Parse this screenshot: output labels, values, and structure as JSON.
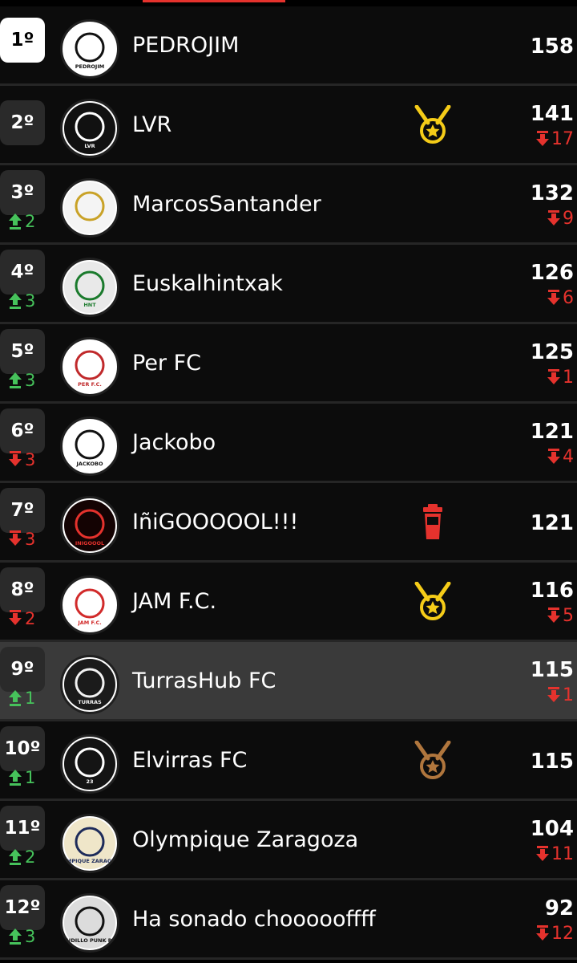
{
  "standings": [
    {
      "rank": "1º",
      "name": "PEDROJIM",
      "points": "158",
      "avatar_text": "PEDROJIM",
      "avatar_bg": "#ffffff",
      "avatar_fg": "#111111"
    },
    {
      "rank": "2º",
      "name": "LVR",
      "points": "141",
      "delta": "17",
      "delta_dir": "down",
      "badge": "medal-gold-icon",
      "avatar_text": "LVR",
      "avatar_bg": "#111111",
      "avatar_fg": "#ffffff"
    },
    {
      "rank": "3º",
      "name": "MarcosSantander",
      "points": "132",
      "delta": "9",
      "delta_dir": "down",
      "rank_change": "2",
      "rank_change_dir": "up",
      "avatar_text": "",
      "avatar_bg": "#f4f4f4",
      "avatar_fg": "#c9a227"
    },
    {
      "rank": "4º",
      "name": "Euskalhintxak",
      "points": "126",
      "delta": "6",
      "delta_dir": "down",
      "rank_change": "3",
      "rank_change_dir": "up",
      "avatar_text": "HNT",
      "avatar_bg": "#e9e9e9",
      "avatar_fg": "#1a7a2c"
    },
    {
      "rank": "5º",
      "name": "Per FC",
      "points": "125",
      "delta": "1",
      "delta_dir": "down",
      "rank_change": "3",
      "rank_change_dir": "up",
      "avatar_text": "PER F.C.",
      "avatar_bg": "#ffffff",
      "avatar_fg": "#c0292b"
    },
    {
      "rank": "6º",
      "name": "Jackobo",
      "points": "121",
      "delta": "4",
      "delta_dir": "down",
      "rank_change": "3",
      "rank_change_dir": "down",
      "avatar_text": "JACKOBO",
      "avatar_bg": "#ffffff",
      "avatar_fg": "#111111"
    },
    {
      "rank": "7º",
      "name": "IñiGOOOOOL!!!",
      "points": "121",
      "rank_change": "3",
      "rank_change_dir": "down",
      "badge": "trash-icon",
      "avatar_text": "INIGOOOL",
      "avatar_bg": "#140303",
      "avatar_fg": "#e5322d"
    },
    {
      "rank": "8º",
      "name": "JAM F.C.",
      "points": "116",
      "delta": "5",
      "delta_dir": "down",
      "rank_change": "2",
      "rank_change_dir": "down",
      "badge": "medal-gold-icon",
      "avatar_text": "JAM F.C.",
      "avatar_bg": "#ffffff",
      "avatar_fg": "#d12a2a"
    },
    {
      "rank": "9º",
      "name": "TurrasHub FC",
      "points": "115",
      "delta": "1",
      "delta_dir": "down",
      "rank_change": "1",
      "rank_change_dir": "up",
      "highlight": true,
      "avatar_text": "TURRAS",
      "avatar_bg": "#1b1b1b",
      "avatar_fg": "#f2f2f2"
    },
    {
      "rank": "10º",
      "name": "Elvirras FC",
      "points": "115",
      "rank_change": "1",
      "rank_change_dir": "up",
      "badge": "medal-bronze-icon",
      "avatar_text": "23",
      "avatar_bg": "#141414",
      "avatar_fg": "#ffffff"
    },
    {
      "rank": "11º",
      "name": "Olympique Zaragoza",
      "points": "104",
      "delta": "11",
      "delta_dir": "down",
      "rank_change": "2",
      "rank_change_dir": "up",
      "avatar_text": "OLYMPIQUE ZARAGOZA",
      "avatar_bg": "#efe6c9",
      "avatar_fg": "#1d2b5a"
    },
    {
      "rank": "12º",
      "name": "Ha sonado choooooffff",
      "points": "92",
      "delta": "12",
      "delta_dir": "down",
      "rank_change": "3",
      "rank_change_dir": "up",
      "avatar_text": "ASTUDILLO PUNK ROCK",
      "avatar_bg": "#dcdcdc",
      "avatar_fg": "#111111"
    }
  ],
  "colors": {
    "up": "#46c25b",
    "down": "#e5322d",
    "gold": "#f5cc18",
    "bronze": "#b0763d",
    "accent": "#e5322d",
    "highlight": "#3a3a3a"
  }
}
